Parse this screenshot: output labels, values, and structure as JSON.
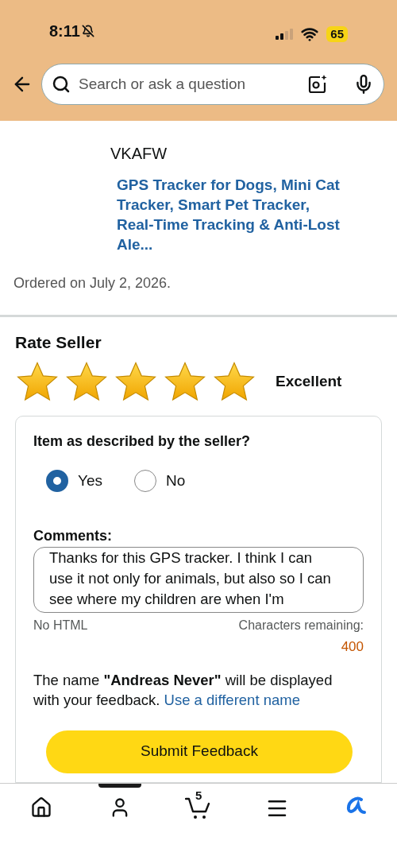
{
  "status_bar": {
    "time": "8:11",
    "battery": "65"
  },
  "search": {
    "placeholder": "Search or ask a question"
  },
  "product": {
    "seller": "VKAFW",
    "title": "GPS Tracker for Dogs, Mini Cat Tracker, Smart Pet Tracker, Real-Time Tracking & Anti-Lost Ale...",
    "ordered": "Ordered on July 2, 2026."
  },
  "rating": {
    "heading": "Rate Seller",
    "stars": 5,
    "label": "Excellent"
  },
  "form": {
    "question": "Item as described by the seller?",
    "options": [
      {
        "label": "Yes",
        "selected": true
      },
      {
        "label": "No",
        "selected": false
      }
    ],
    "comments_label": "Comments:",
    "comments_value": "Thanks for this GPS tracker. I think I can use it not only for animals, but also so I can see where my children are when I'm",
    "hint": "No HTML",
    "remaining_label": "Characters remaining:",
    "remaining": "400",
    "name_notice": "The name **\"Andreas Never\"** will be displayed with your feedback.",
    "name_link": "Use a different name",
    "submit": "Submit Feedback"
  },
  "nav": [
    {
      "kind": "home",
      "selected": false
    },
    {
      "kind": "account",
      "selected": true
    },
    {
      "kind": "cart",
      "badge": "5",
      "selected": false
    },
    {
      "kind": "menu",
      "selected": false
    },
    {
      "kind": "assistant",
      "selected": false
    }
  ]
}
